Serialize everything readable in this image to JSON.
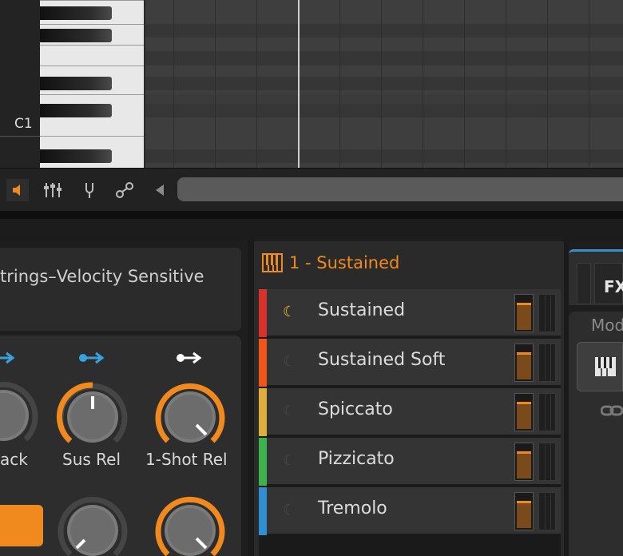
{
  "piano_roll": {
    "note_label": "C1"
  },
  "toolbar": {
    "items": [
      {
        "icon": "speaker-icon"
      },
      {
        "icon": "mixer-sliders-icon"
      },
      {
        "icon": "tuning-fork-icon"
      },
      {
        "icon": "modulation-link-icon"
      },
      {
        "icon": "scroll-left-arrow-icon"
      }
    ]
  },
  "device": {
    "preset_name": "trings–Velocity Sensitive",
    "knobs": [
      {
        "label": "ack"
      },
      {
        "label": "Sus Rel"
      },
      {
        "label": "1-Shot Rel"
      }
    ]
  },
  "variations": {
    "header": "1 - Sustained",
    "items": [
      {
        "label": "Sustained",
        "color": "#d8322e",
        "active": true
      },
      {
        "label": "Sustained Soft",
        "color": "#f0561a",
        "active": false
      },
      {
        "label": "Spiccato",
        "color": "#e0ae3c",
        "active": false
      },
      {
        "label": "Pizzicato",
        "color": "#3db24d",
        "active": false
      },
      {
        "label": "Tremolo",
        "color": "#2f8fd1",
        "active": false
      }
    ]
  },
  "right_panel": {
    "fx_label": "FX",
    "mod_label": "Mod"
  },
  "colors": {
    "accent": "#f08a1f",
    "blue": "#3aa0e0"
  }
}
